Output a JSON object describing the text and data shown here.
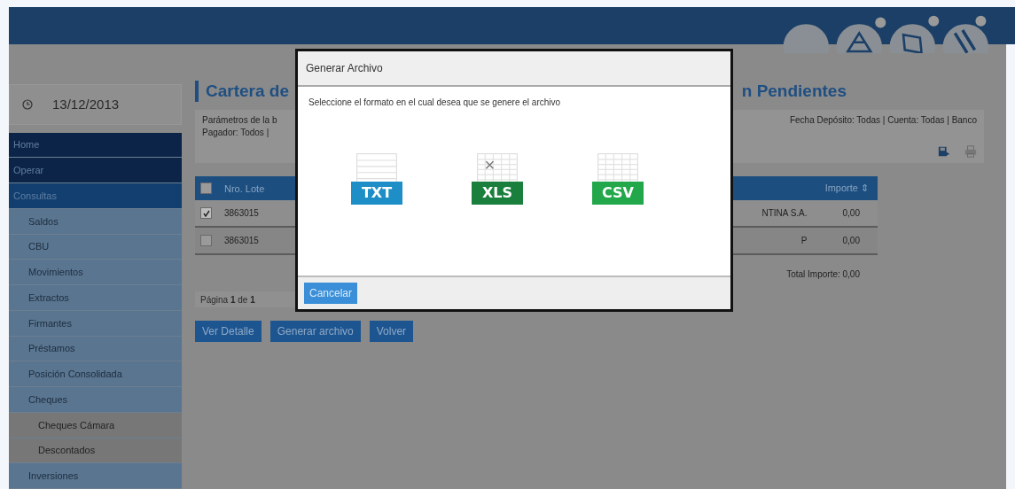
{
  "date": "13/12/2013",
  "sidebar": {
    "items": [
      {
        "label": "Home"
      },
      {
        "label": "Operar"
      },
      {
        "label": "Consultas",
        "children": [
          {
            "label": "Saldos"
          },
          {
            "label": "CBU"
          },
          {
            "label": "Movimientos"
          },
          {
            "label": "Extractos"
          },
          {
            "label": "Firmantes"
          },
          {
            "label": "Préstamos"
          },
          {
            "label": "Posición Consolidada"
          },
          {
            "label": "Cheques",
            "children": [
              {
                "label": "Cheques Cámara"
              },
              {
                "label": "Descontados"
              }
            ]
          },
          {
            "label": "Inversiones"
          }
        ]
      }
    ]
  },
  "title": {
    "left": "Cartera de",
    "right": "n Pendientes"
  },
  "parameters": {
    "left_lines": [
      "Parámetros de la b",
      "Pagador: Todos |"
    ],
    "right": "Fecha Depósito: Todas | Cuenta: Todas | Banco"
  },
  "table": {
    "header_checked": false,
    "columns": {
      "left": "Nro. Lote",
      "right": "Importe ⇕"
    },
    "rows": [
      {
        "checked": true,
        "lote": "3863015",
        "column_3": "NTINA S.A.",
        "importe": "0,00"
      },
      {
        "checked": false,
        "lote": "3863015",
        "column_3": "P",
        "importe": "0,00"
      }
    ],
    "total": "Total Importe: 0,00"
  },
  "pagination": "Página **1** de **1**",
  "buttons": [
    "Ver Detalle",
    "Generar archivo",
    "Volver"
  ],
  "dialog": {
    "title": "Generar Archivo",
    "message": "Seleccione el formato en el cual desea que se genere el archivo",
    "formats": [
      {
        "label": "TXT",
        "kind": "txt",
        "color": "#1e8fc6"
      },
      {
        "label": "XLS",
        "kind": "xls",
        "color": "#1a7f3c"
      },
      {
        "label": "CSV",
        "kind": "csv",
        "color": "#22a84a"
      }
    ],
    "cancel": "Cancelar"
  }
}
